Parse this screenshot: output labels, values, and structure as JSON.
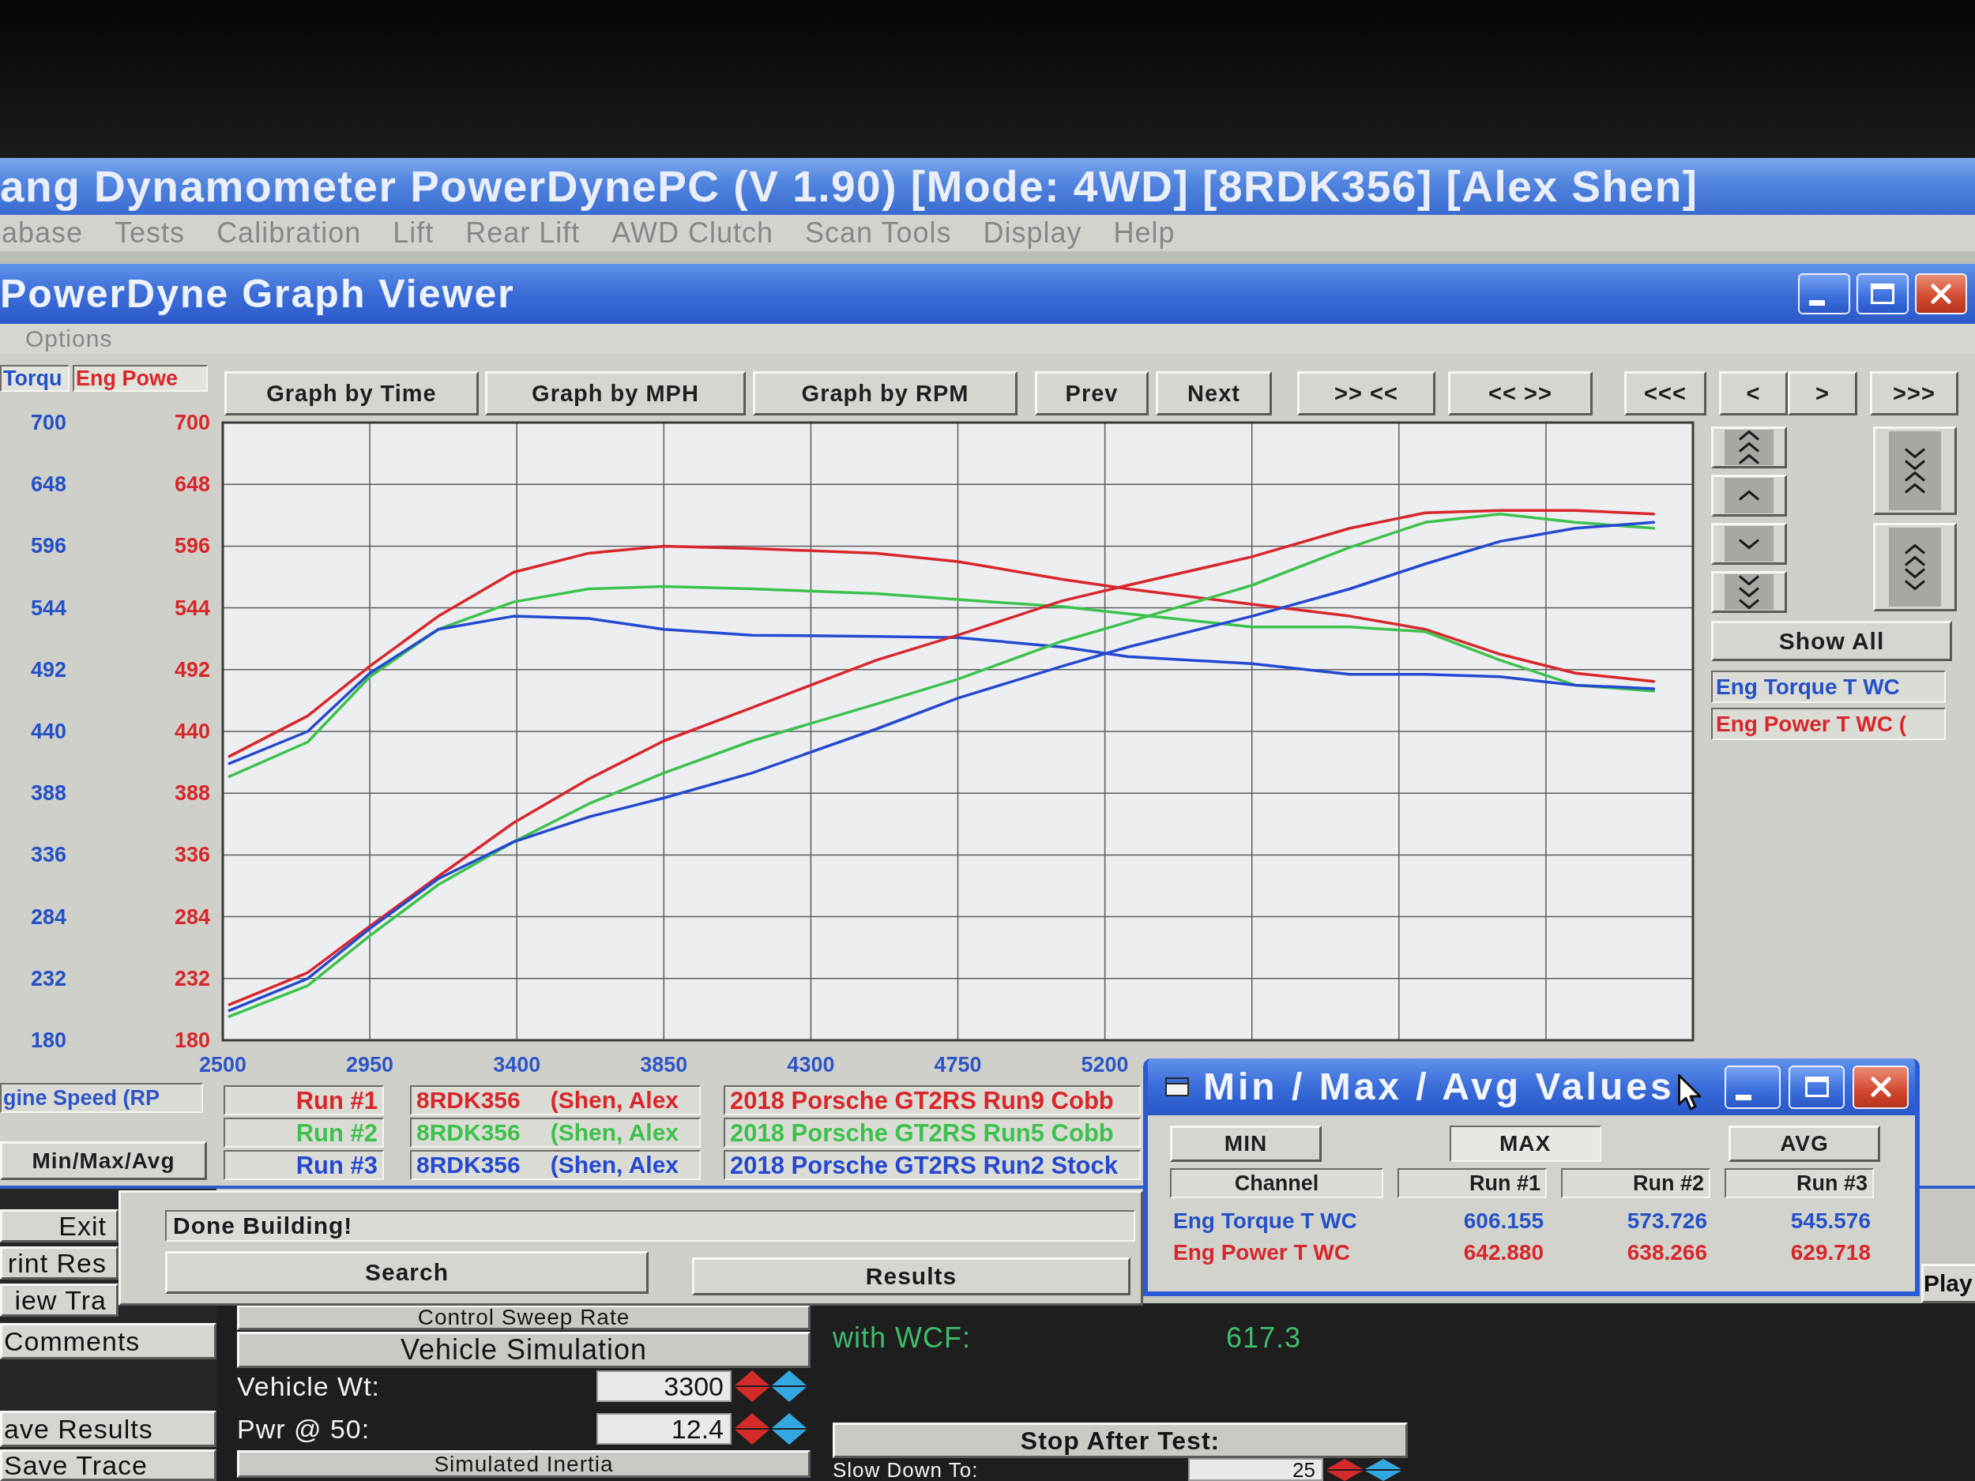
{
  "app_window": {
    "title": "ang Dynamometer PowerDynePC (V 1.90) [Mode: 4WD] [8RDK356] [Alex Shen]",
    "menu": [
      "abase",
      "Tests",
      "Calibration",
      "Lift",
      "Rear Lift",
      "AWD Clutch",
      "Scan Tools",
      "Display",
      "Help"
    ]
  },
  "graph_viewer": {
    "title": "PowerDyne Graph Viewer",
    "menu": [
      "Options"
    ],
    "axis_channels": [
      {
        "label": "Torqu",
        "color": "#2450c8"
      },
      {
        "label": "Eng Powe",
        "color": "#d8262a"
      }
    ],
    "toolbar": [
      "Graph by Time",
      "Graph by MPH",
      "Graph by RPM",
      "Prev",
      "Next",
      ">> <<",
      "<< >>",
      "<<<",
      "<",
      ">",
      ">>>"
    ],
    "chart_data": [
      {
        "type": "line",
        "xlim": [
          2500,
          7000
        ],
        "xticks": [
          2500,
          2950,
          3400,
          3850,
          4300,
          4750,
          5200
        ],
        "ylim": [
          180,
          700
        ],
        "yticks": [
          180,
          232,
          284,
          336,
          388,
          440,
          492,
          544,
          596,
          648,
          700
        ],
        "y2lim": [
          180,
          700
        ],
        "y2ticks": [
          180,
          232,
          284,
          336,
          388,
          440,
          492,
          544,
          596,
          648,
          700
        ],
        "grid": true,
        "x": [
          2520,
          2760,
          2950,
          3160,
          3390,
          3620,
          3850,
          4120,
          4500,
          4750,
          5070,
          5270,
          5650,
          5950,
          6180,
          6410,
          6640,
          6880
        ],
        "series": [
          {
            "color": "#d8262a",
            "values": [
              419,
              453,
              495,
              537,
              574,
              590,
              596,
              594,
              590,
              583,
              568,
              560,
              547,
              537,
              526,
              505,
              489,
              482
            ]
          },
          {
            "color": "#3cc24c",
            "values": [
              402,
              431,
              486,
              526,
              549,
              560,
              562,
              560,
              556,
              551,
              545,
              539,
              528,
              528,
              524,
              500,
              479,
              474
            ]
          },
          {
            "color": "#2448d0",
            "values": [
              413,
              440,
              489,
              526,
              537,
              535,
              526,
              521,
              520,
              519,
              511,
              503,
              497,
              488,
              488,
              486,
              479,
              476
            ]
          },
          {
            "color": "#d8262a",
            "values": [
              210,
              237,
              276,
              318,
              363,
              400,
              432,
              460,
              500,
              521,
              550,
              563,
              587,
              611,
              624,
              626,
              626,
              623
            ]
          },
          {
            "color": "#3cc24c",
            "values": [
              200,
              226,
              268,
              311,
              347,
              379,
              405,
              432,
              463,
              484,
              516,
              532,
              563,
              595,
              616,
              623,
              616,
              611
            ]
          },
          {
            "color": "#2448d0",
            "values": [
              205,
              232,
              274,
              316,
              347,
              368,
              384,
              405,
              442,
              468,
              495,
              511,
              537,
              560,
              581,
              600,
              611,
              616
            ]
          }
        ]
      }
    ],
    "side_panel": {
      "show_all": "Show All",
      "channels": [
        {
          "label": "Eng Torque T WC",
          "color": "#2450c8"
        },
        {
          "label": "Eng Power T WC (",
          "color": "#d8262a"
        }
      ]
    },
    "x_channel": "gine Speed (RP",
    "min_max_avg_button": "Min/Max/Avg",
    "runs": [
      {
        "label": "Run #1",
        "vehicle": "8RDK356",
        "customer": "(Shen, Alex",
        "description": "2018 Porsche GT2RS Run9 Cobb",
        "color": "#d8262a"
      },
      {
        "label": "Run #2",
        "vehicle": "8RDK356",
        "customer": "(Shen, Alex",
        "description": "2018 Porsche GT2RS Run5 Cobb",
        "color": "#3cc24c"
      },
      {
        "label": "Run #3",
        "vehicle": "8RDK356",
        "customer": "(Shen, Alex",
        "description": "2018 Porsche GT2RS Run2 Stock",
        "color": "#2448d0"
      }
    ]
  },
  "status_dialog": {
    "message": "Done Building!",
    "buttons": [
      "Search",
      "Results"
    ]
  },
  "min_max_avg_window": {
    "title": "Min / Max / Avg Values",
    "modes": [
      {
        "label": "MIN",
        "selected": false
      },
      {
        "label": "MAX",
        "selected": true
      },
      {
        "label": "AVG",
        "selected": false
      }
    ],
    "columns": [
      "Channel",
      "Run #1",
      "Run #2",
      "Run #3"
    ],
    "rows": [
      {
        "channel": "Eng Torque T WC",
        "color": "#2450c8",
        "values": [
          "606.155",
          "573.726",
          "545.576"
        ]
      },
      {
        "channel": "Eng Power T WC",
        "color": "#d8262a",
        "values": [
          "642.880",
          "638.266",
          "629.718"
        ]
      }
    ]
  },
  "main_panel": {
    "side_buttons": [
      "Exit",
      "rint Res",
      "iew Tra",
      "Comments",
      "ave Results",
      "Save Trace"
    ],
    "sweep_header": "Control Sweep Rate",
    "vehicle_simulation": {
      "title": "Vehicle Simulation",
      "fields": [
        {
          "label": "Vehicle Wt:",
          "value": "3300"
        },
        {
          "label": "Pwr @ 50:",
          "value": "12.4"
        }
      ],
      "footer": "Simulated Inertia"
    },
    "wcf": {
      "label": "with WCF:",
      "value": "617.3"
    },
    "stop_after_test": {
      "title": "Stop After Test:",
      "fields": [
        {
          "label": "Slow Down To:",
          "value": "25"
        }
      ]
    },
    "play_button": "Play"
  }
}
